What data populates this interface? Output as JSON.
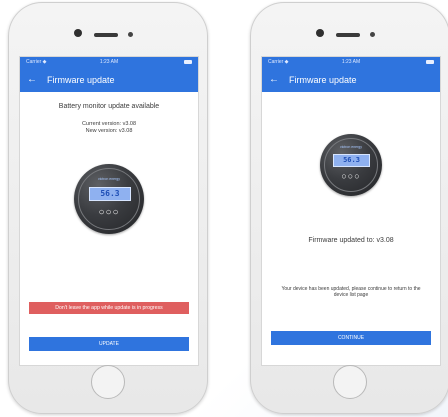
{
  "common": {
    "status_carrier": "Carrier ◆",
    "status_time": "1:23 AM",
    "back_arrow": "←",
    "title": "Firmware update"
  },
  "left": {
    "headline": "Battery monitor update available",
    "current_version": "Current version: v3.08",
    "new_version": "New version: v3.08",
    "device_brand": "victron energy",
    "device_reading": "56.3",
    "device_buttons": "○○○",
    "warning": "Don't leave the app while update is in progress",
    "button": "UPDATE"
  },
  "right": {
    "device_brand": "victron energy",
    "device_reading": "56.3",
    "device_buttons": "○○○",
    "updated_text": "Firmware updated to: v3.08",
    "message": "Your device has been updated, please continue to return to the device list page",
    "button": "CONTINUE"
  },
  "colors": {
    "accent": "#2f74de",
    "warning": "#df5f5f",
    "lcd": "#8fb1f0"
  },
  "icons": {
    "back": "back-arrow-icon",
    "battery": "battery-icon",
    "home": "home-button-icon"
  }
}
